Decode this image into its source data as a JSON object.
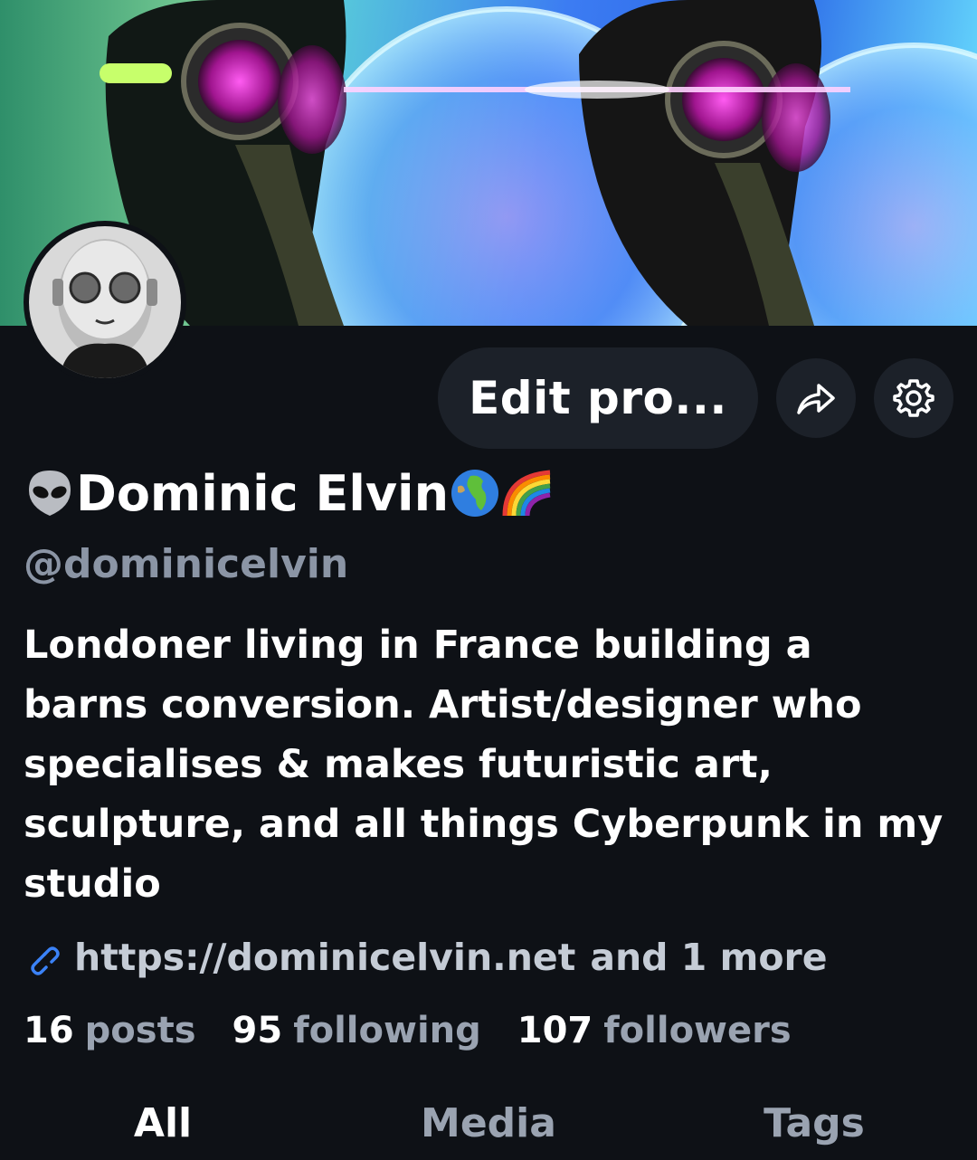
{
  "profile": {
    "display_name": "Dominic Elvin",
    "name_emoji_prefix": "alien-icon",
    "name_emoji_suffix": [
      "globe-europe-africa-icon",
      "rainbow-icon"
    ],
    "handle": "@dominicelvin",
    "bio": "Londoner living in France building a barns conversion. Artist/designer who specialises & makes futuristic art, sculpture, and all things Cyberpunk in my studio",
    "link": "https://dominicelvin.net",
    "link_more": "and 1 more"
  },
  "actions": {
    "edit_label": "Edit pro...",
    "share_icon": "share-icon",
    "settings_icon": "gear-icon"
  },
  "stats": {
    "posts": {
      "count": "16",
      "label": "posts"
    },
    "following": {
      "count": "95",
      "label": "following"
    },
    "followers": {
      "count": "107",
      "label": "followers"
    }
  },
  "tabs": [
    {
      "label": "All",
      "active": true
    },
    {
      "label": "Media",
      "active": false
    },
    {
      "label": "Tags",
      "active": false
    }
  ],
  "colors": {
    "background": "#0e1116",
    "button_bg": "#1c2129",
    "muted_text": "#8b95a5",
    "link_icon": "#3b82f6"
  }
}
